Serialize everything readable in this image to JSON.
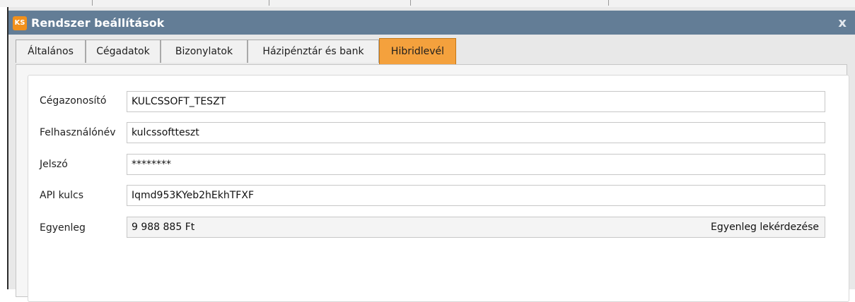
{
  "window": {
    "title": "Rendszer beállítások",
    "logo_text": "KS",
    "close_glyph": "x"
  },
  "tabs": [
    {
      "label": "Általános",
      "active": false
    },
    {
      "label": "Cégadatok",
      "active": false
    },
    {
      "label": "Bizonylatok",
      "active": false
    },
    {
      "label": "Házipénztár és bank",
      "active": false
    },
    {
      "label": "Hibridlevél",
      "active": true
    }
  ],
  "form": {
    "company_id": {
      "label": "Cégazonosító",
      "value": "KULCSSOFT_TESZT"
    },
    "username": {
      "label": "Felhasználónév",
      "value": "kulcssoftteszt"
    },
    "password": {
      "label": "Jelszó",
      "value": "********"
    },
    "api_key": {
      "label": "API kulcs",
      "value": "Iqmd953KYeb2hEkhTFXF"
    },
    "balance": {
      "label": "Egyenleg",
      "value": "9 988 885 Ft",
      "query_label": "Egyenleg lekérdezése"
    }
  },
  "colors": {
    "titlebar": "#637d96",
    "active_tab": "#f4a13d",
    "brand_orange": "#f1901c"
  }
}
